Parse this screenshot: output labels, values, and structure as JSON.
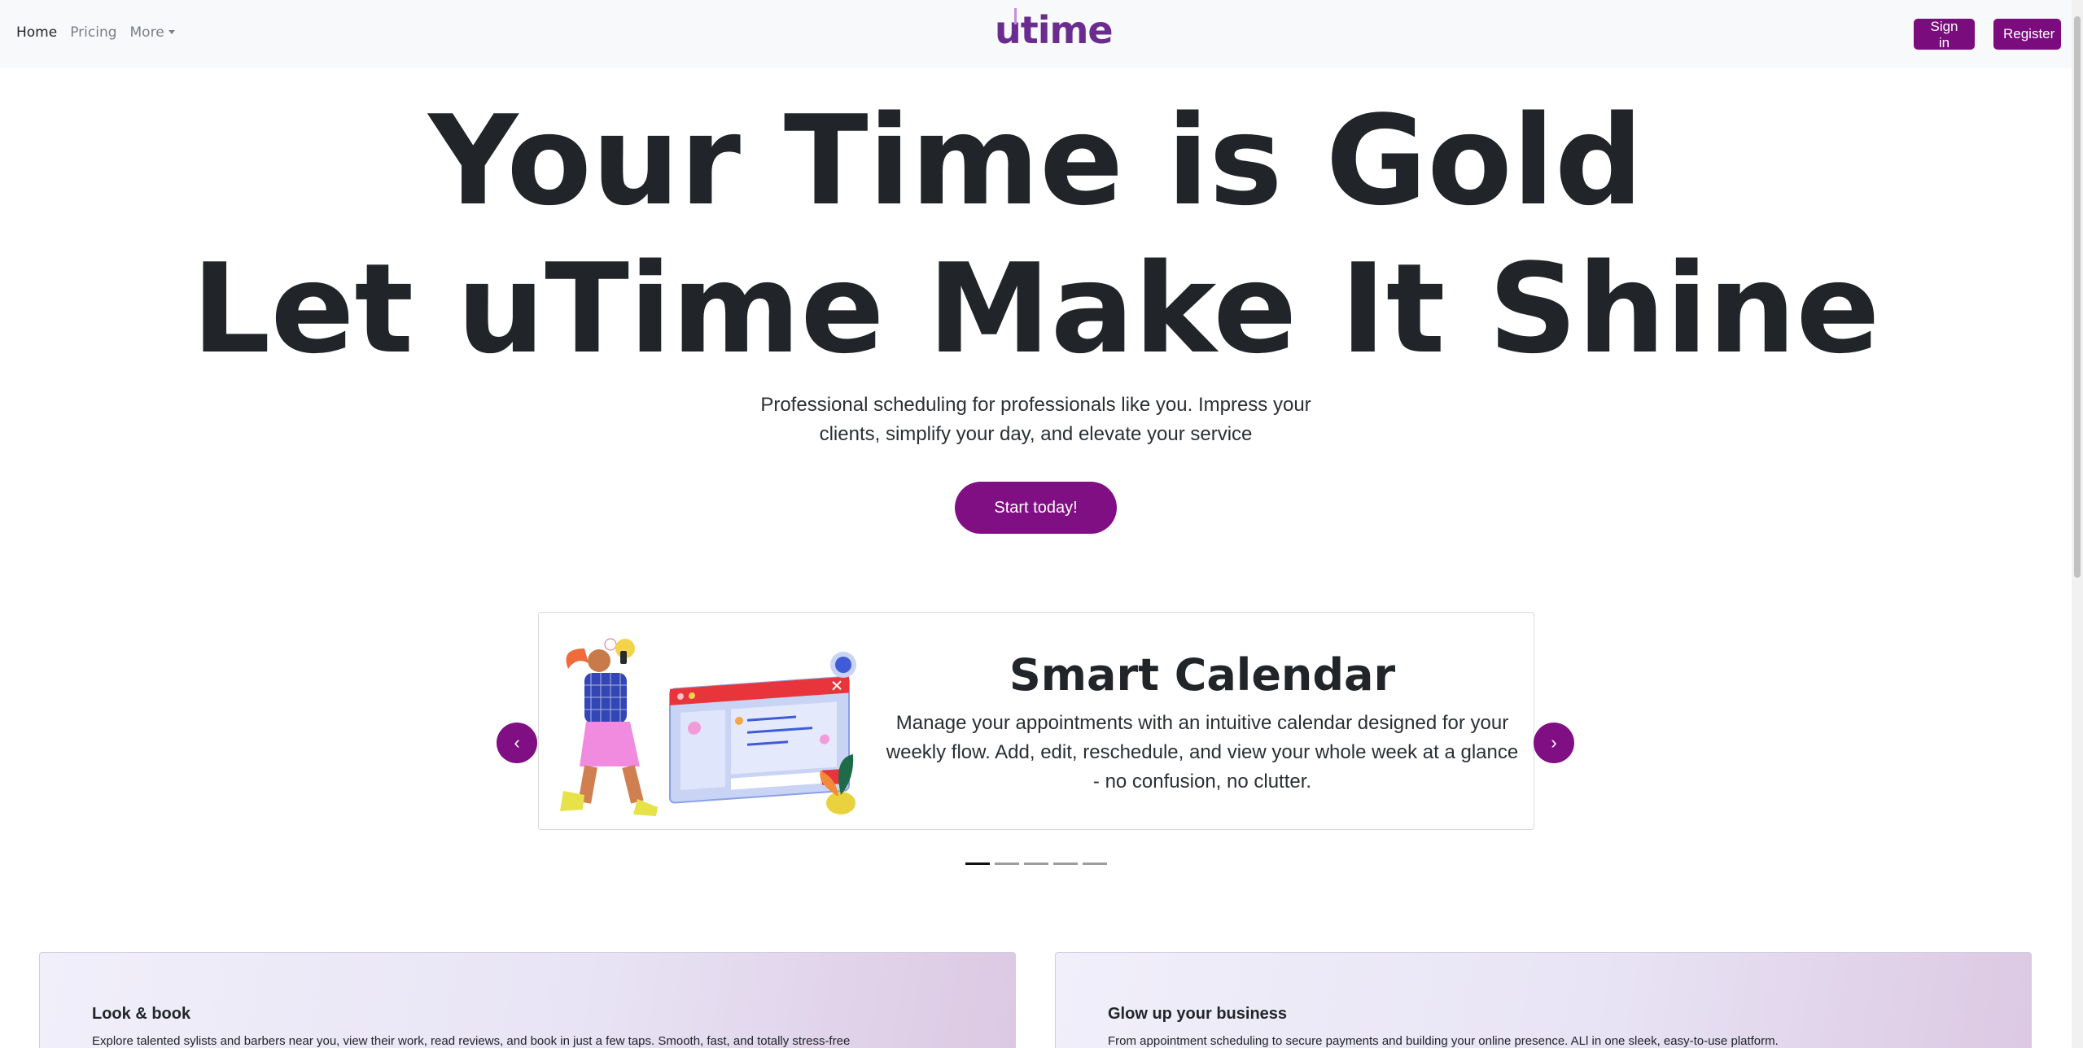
{
  "nav": {
    "links": [
      {
        "label": "Home"
      },
      {
        "label": "Pricing"
      },
      {
        "label": "More"
      }
    ],
    "logo": "utime",
    "sign_in": "Sign in",
    "register": "Register"
  },
  "hero": {
    "line1": "Your Time is Gold",
    "line2": "Let uTime Make It Shine",
    "subtitle": "Professional scheduling for professionals like you. Impress your clients, simplify your day, and elevate your service",
    "cta": "Start today!"
  },
  "carousel": {
    "title": "Smart Calendar",
    "text": "Manage your appointments with an intuitive calendar designed for your weekly flow. Add, edit, reschedule, and view your whole week at a glance - no confusion, no clutter.",
    "prev": "‹",
    "next": "›",
    "slide_count": 5,
    "active_index": 0
  },
  "cards": [
    {
      "title": "Look & book",
      "text": "Explore talented sylists and barbers near you, view their work, read reviews, and book in just a few taps. Smooth, fast, and totally stress-free"
    },
    {
      "title": "Glow up your business",
      "text": "From appointment scheduling to secure payments and building your online presence. ALl in one sleek, easy-to-use platform."
    }
  ],
  "colors": {
    "brand": "#800f84",
    "logo": "#6a2d8f",
    "navbar_bg": "#f8f9fa"
  }
}
